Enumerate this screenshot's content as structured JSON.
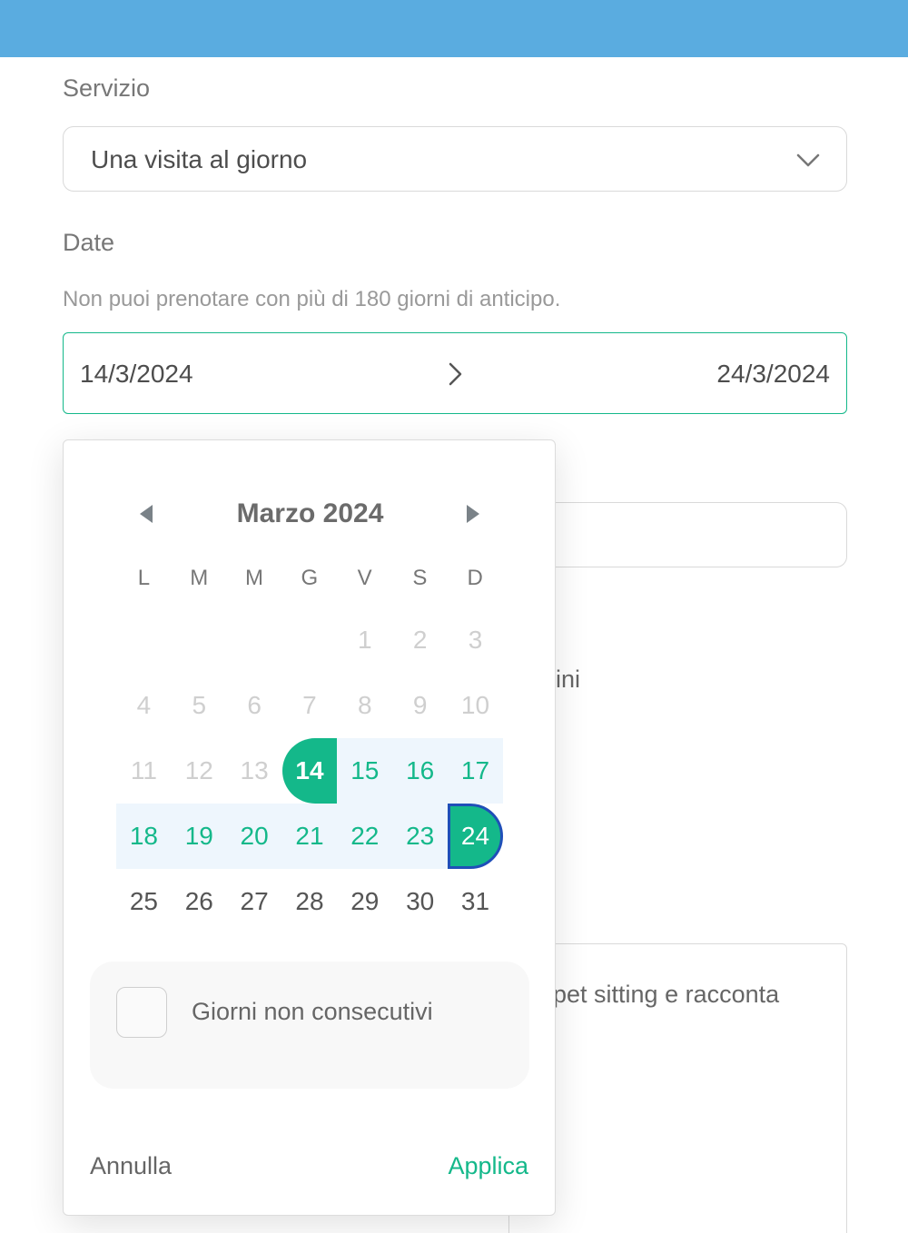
{
  "form": {
    "service_label": "Servizio",
    "service_value": "Una visita al giorno",
    "date_label": "Date",
    "date_hint": "Non puoi prenotare con più di 180 giorni di anticipo.",
    "start_date": "14/3/2024",
    "end_date": "24/3/2024",
    "partial_text_1": "ini",
    "partial_text_2": "pet sitting e racconta"
  },
  "calendar": {
    "month_title": "Marzo 2024",
    "weekdays": [
      "L",
      "M",
      "M",
      "G",
      "V",
      "S",
      "D"
    ],
    "weeks": [
      [
        null,
        null,
        null,
        null,
        1,
        2,
        3
      ],
      [
        4,
        5,
        6,
        7,
        8,
        9,
        10
      ],
      [
        11,
        12,
        13,
        14,
        15,
        16,
        17
      ],
      [
        18,
        19,
        20,
        21,
        22,
        23,
        24
      ],
      [
        25,
        26,
        27,
        28,
        29,
        30,
        31
      ]
    ],
    "range_start": 14,
    "range_end": 24,
    "first_enabled_day": 14,
    "non_consecutive_label": "Giorni non consecutivi",
    "non_consecutive_checked": false,
    "cancel_label": "Annulla",
    "apply_label": "Applica"
  },
  "colors": {
    "topbar": "#5aace0",
    "accent": "#14b88a",
    "range_bg": "#eef6fd",
    "end_outline": "#1f4fb8"
  },
  "icons": {
    "select_chevron": "chevron-down-icon",
    "range_arrow": "chevron-right-icon",
    "prev_month": "triangle-left-icon",
    "next_month": "triangle-right-icon"
  }
}
